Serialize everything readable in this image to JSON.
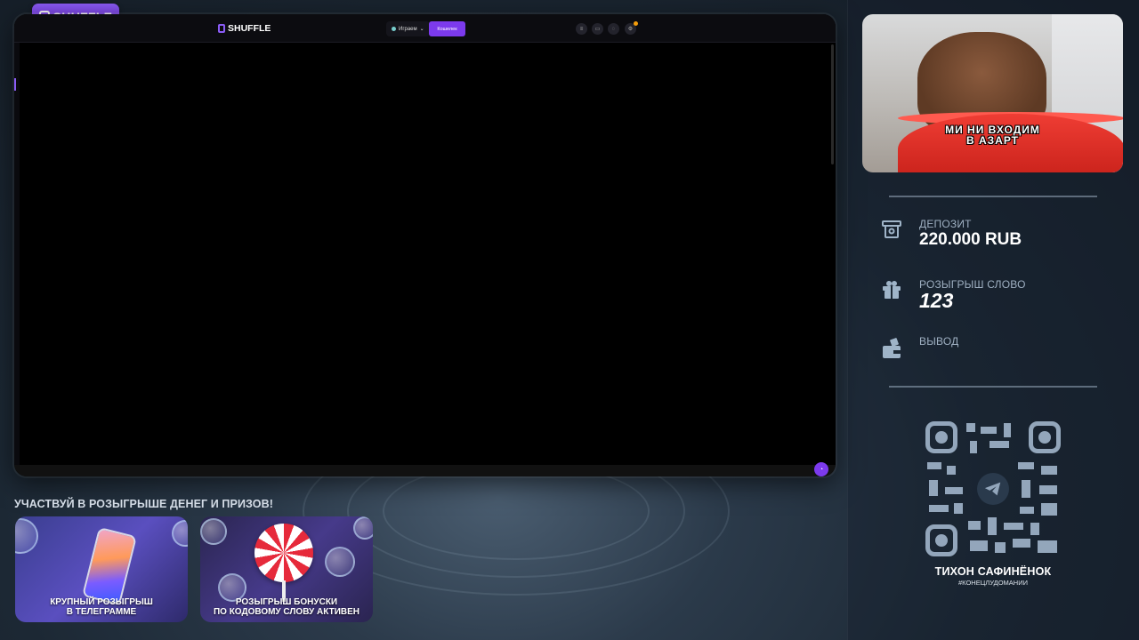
{
  "overlay": {
    "brand_badge": "SHUFFLE",
    "promo_title": "УЧАСТВУЙ В РОЗЫГРЫШЕ ДЕНЕГ И ПРИЗОВ!",
    "promo_cards": [
      {
        "caption_line1": "КРУПНЫЙ РОЗЫГРЫШ",
        "caption_line2": "В ТЕЛЕГРАММЕ"
      },
      {
        "caption_line1": "РОЗЫГРЫШ БОНУСКИ",
        "caption_line2": "ПО КОДОВОМУ СЛОВУ АКТИВЕН"
      }
    ]
  },
  "site": {
    "logo": "SHUFFLE",
    "play_label": "Играем",
    "wallet_label": "Кошелек",
    "header_icons": [
      "menu-icon",
      "shop-icon",
      "chat-icon",
      "settings-icon"
    ]
  },
  "webcam": {
    "meme_line1": "МИ НИ ВХОДИМ",
    "meme_line2": "В АЗАРТ"
  },
  "stats": {
    "deposit_label": "ДЕПОЗИТ",
    "deposit_value": "220.000 RUB",
    "giveaway_label": "РОЗЫГРЫШ СЛОВО",
    "giveaway_value": "123",
    "withdraw_label": "ВЫВОД",
    "withdraw_value": ""
  },
  "streamer": {
    "name": "ТИХОН САФИНЁНОК",
    "hashtag": "#КОНЕЦЛУДОМАНИИ"
  },
  "colors": {
    "accent": "#7c3aed",
    "panel_text": "#9fb0c2",
    "qr": "#93a6bb"
  }
}
